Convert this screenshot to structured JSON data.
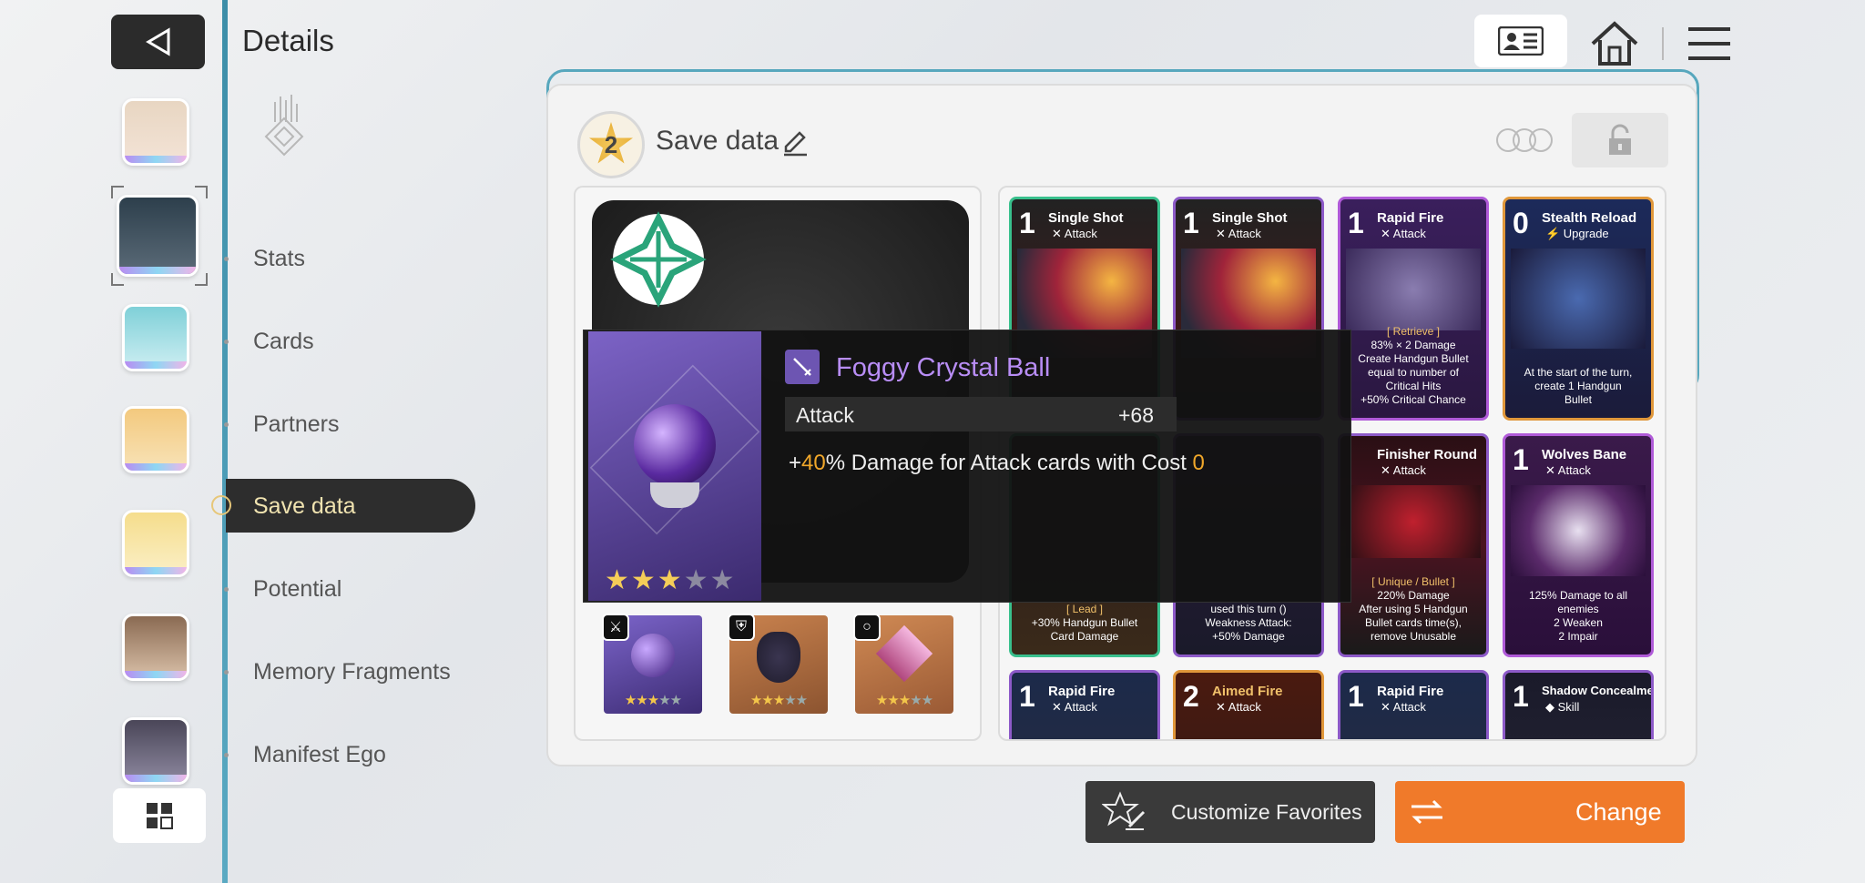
{
  "header": {
    "title": "Details"
  },
  "nav": {
    "items": [
      {
        "label": "Stats"
      },
      {
        "label": "Cards"
      },
      {
        "label": "Partners"
      },
      {
        "label": "Save data"
      },
      {
        "label": "Potential"
      },
      {
        "label": "Memory Fragments"
      },
      {
        "label": "Manifest Ego"
      }
    ],
    "active": "Save data"
  },
  "save": {
    "slot_number": "2",
    "title": "Save data"
  },
  "tooltip": {
    "item_name": "Foggy Crystal Ball",
    "stat_label": "Attack",
    "stat_value": "+68",
    "effect_prefix": "+",
    "effect_pct": "40",
    "effect_mid": "% Damage for Attack cards with Cost ",
    "effect_cost": "0",
    "stars_filled": 3,
    "stars_total": 5,
    "name_color": "#b88df5"
  },
  "equipment": [
    {
      "type": "sword-icon",
      "stars_filled": 3,
      "stars_total": 5
    },
    {
      "type": "armor-icon",
      "stars_filled": 3,
      "stars_total": 5
    },
    {
      "type": "ring-icon",
      "stars_filled": 3,
      "stars_total": 5
    }
  ],
  "cards": [
    {
      "cost": "1",
      "name": "Single Shot",
      "type": "Attack",
      "desc": ""
    },
    {
      "cost": "1",
      "name": "Single Shot",
      "type": "Attack",
      "desc": ""
    },
    {
      "cost": "1",
      "name": "Rapid Fire",
      "type": "Attack",
      "desc_lines": [
        "[ Retrieve ]",
        "83% × 2 Damage",
        "Create Handgun Bullet",
        "equal to number of",
        "Critical Hits",
        "+50% Critical Chance"
      ]
    },
    {
      "cost": "0",
      "name": "Stealth Reload",
      "type": "Upgrade",
      "desc_lines": [
        "At the start of the turn,",
        "create 1 Handgun",
        "Bullet"
      ]
    },
    {
      "cost": "",
      "name": "",
      "type": "",
      "desc_lines": [
        "[ Lead ]",
        "+30% Handgun Bullet",
        "Card Damage"
      ]
    },
    {
      "cost": "",
      "name": "",
      "type": "",
      "desc_lines": [
        "used this turn ()",
        "Weakness Attack:",
        "+50% Damage"
      ]
    },
    {
      "cost": "",
      "name": "Finisher Round",
      "type": "Attack",
      "desc_lines": [
        "[ Unique / Bullet ]",
        "220% Damage",
        "After using 5 Handgun",
        "Bullet cards  time(s),",
        "remove Unusable"
      ]
    },
    {
      "cost": "1",
      "name": "Wolves Bane",
      "type": "Attack",
      "desc_lines": [
        "125% Damage to all",
        "enemies",
        "2 Weaken",
        "2 Impair"
      ]
    },
    {
      "cost": "1",
      "name": "Rapid Fire",
      "type": "Attack",
      "desc_lines": []
    },
    {
      "cost": "2",
      "name": "Aimed Fire",
      "type": "Attack",
      "desc_lines": []
    },
    {
      "cost": "1",
      "name": "Rapid Fire",
      "type": "Attack",
      "desc_lines": []
    },
    {
      "cost": "1",
      "name": "Shadow Concealment",
      "type": "Skill",
      "desc_lines": []
    }
  ],
  "buttons": {
    "favorites": "Customize Favorites",
    "change": "Change"
  },
  "colors": {
    "accent_orange": "#f07a2a",
    "rail_teal": "#3d8ea8",
    "card_green_border": "#39c08d",
    "card_purple_border": "#b05ad8"
  }
}
